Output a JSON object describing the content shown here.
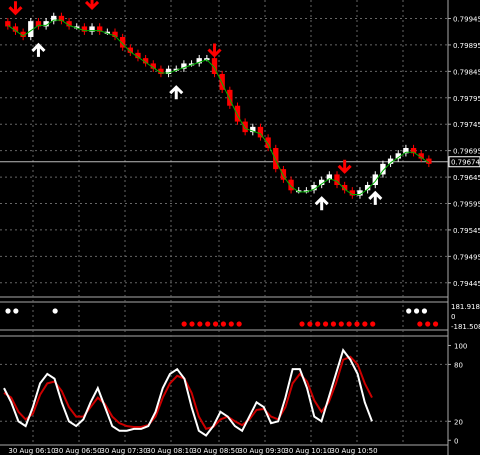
{
  "price_axis": {
    "labels": [
      "0.79945",
      "0.79895",
      "0.79845",
      "0.79795",
      "0.79745",
      "0.79695",
      "0.79645",
      "0.79595",
      "0.79545",
      "0.79495",
      "0.79445"
    ],
    "current_price": "0.79674"
  },
  "signal_axis": {
    "labels": [
      "181.9186",
      "0",
      "-181.508"
    ]
  },
  "stoch_axis": {
    "labels": [
      "100",
      "80",
      "20",
      "0"
    ]
  },
  "time_axis": {
    "labels": [
      "30 Aug 06:10",
      "30 Aug 06:50",
      "30 Aug 07:30",
      "30 Aug 08:10",
      "30 Aug 08:50",
      "30 Aug 09:30",
      "30 Aug 10:10",
      "30 Aug 10:50"
    ]
  },
  "colors": {
    "bull": "#ffffff",
    "bear": "#ff0000",
    "ma": "#00b000",
    "grid": "#666666",
    "up_arrow": "#ffffff",
    "down_arrow": "#ff0000",
    "stoch_main": "#ffffff",
    "stoch_signal": "#cc0000"
  },
  "chart_data": [
    {
      "type": "candlestick",
      "title": "",
      "ylim": [
        0.7942,
        0.7998
      ],
      "candles_close": [
        0.7993,
        0.7992,
        0.7991,
        0.7994,
        0.7993,
        0.7994,
        0.7995,
        0.7994,
        0.7993,
        0.7993,
        0.7992,
        0.7993,
        0.7992,
        0.7992,
        0.7991,
        0.7989,
        0.7988,
        0.7987,
        0.7986,
        0.7985,
        0.7984,
        0.7985,
        0.7985,
        0.7986,
        0.7986,
        0.7987,
        0.7987,
        0.7984,
        0.7981,
        0.7978,
        0.7975,
        0.7973,
        0.7974,
        0.7972,
        0.797,
        0.7966,
        0.7964,
        0.7962,
        0.7962,
        0.7962,
        0.7963,
        0.7964,
        0.7965,
        0.7963,
        0.7962,
        0.7961,
        0.7962,
        0.7963,
        0.7965,
        0.7967,
        0.7968,
        0.7969,
        0.797,
        0.7969,
        0.7968,
        0.7967
      ],
      "signals": [
        {
          "kind": "sell",
          "index": 1
        },
        {
          "kind": "buy",
          "index": 4
        },
        {
          "kind": "sell",
          "index": 11
        },
        {
          "kind": "buy",
          "index": 22
        },
        {
          "kind": "sell",
          "index": 27
        },
        {
          "kind": "buy",
          "index": 41
        },
        {
          "kind": "sell",
          "index": 44
        },
        {
          "kind": "buy",
          "index": 48
        }
      ]
    },
    {
      "type": "dots",
      "white_dots_indices": [
        0,
        1,
        6,
        51,
        52,
        53
      ],
      "red_dots_indices": [
        13,
        14,
        15,
        16,
        17,
        18,
        19,
        20,
        28,
        29,
        30,
        31,
        32,
        33,
        34,
        35,
        36,
        37,
        43,
        44,
        45
      ]
    },
    {
      "type": "line",
      "ylim": [
        -5,
        110
      ],
      "series": [
        {
          "values": [
            55,
            40,
            20,
            15,
            35,
            60,
            70,
            65,
            40,
            20,
            15,
            22,
            40,
            55,
            35,
            15,
            10,
            10,
            12,
            12,
            15,
            30,
            55,
            70,
            75,
            65,
            35,
            10,
            5,
            15,
            30,
            25,
            15,
            10,
            25,
            40,
            35,
            18,
            20,
            45,
            75,
            75,
            55,
            25,
            20,
            45,
            70,
            95,
            85,
            70,
            40,
            20
          ]
        },
        {
          "values": [
            50,
            45,
            30,
            22,
            28,
            48,
            60,
            62,
            52,
            35,
            25,
            25,
            35,
            45,
            38,
            25,
            18,
            15,
            14,
            14,
            16,
            25,
            45,
            60,
            68,
            65,
            50,
            25,
            12,
            14,
            22,
            25,
            20,
            16,
            22,
            32,
            33,
            25,
            22,
            35,
            60,
            70,
            62,
            42,
            30,
            40,
            60,
            85,
            88,
            80,
            60,
            45
          ]
        }
      ]
    }
  ]
}
